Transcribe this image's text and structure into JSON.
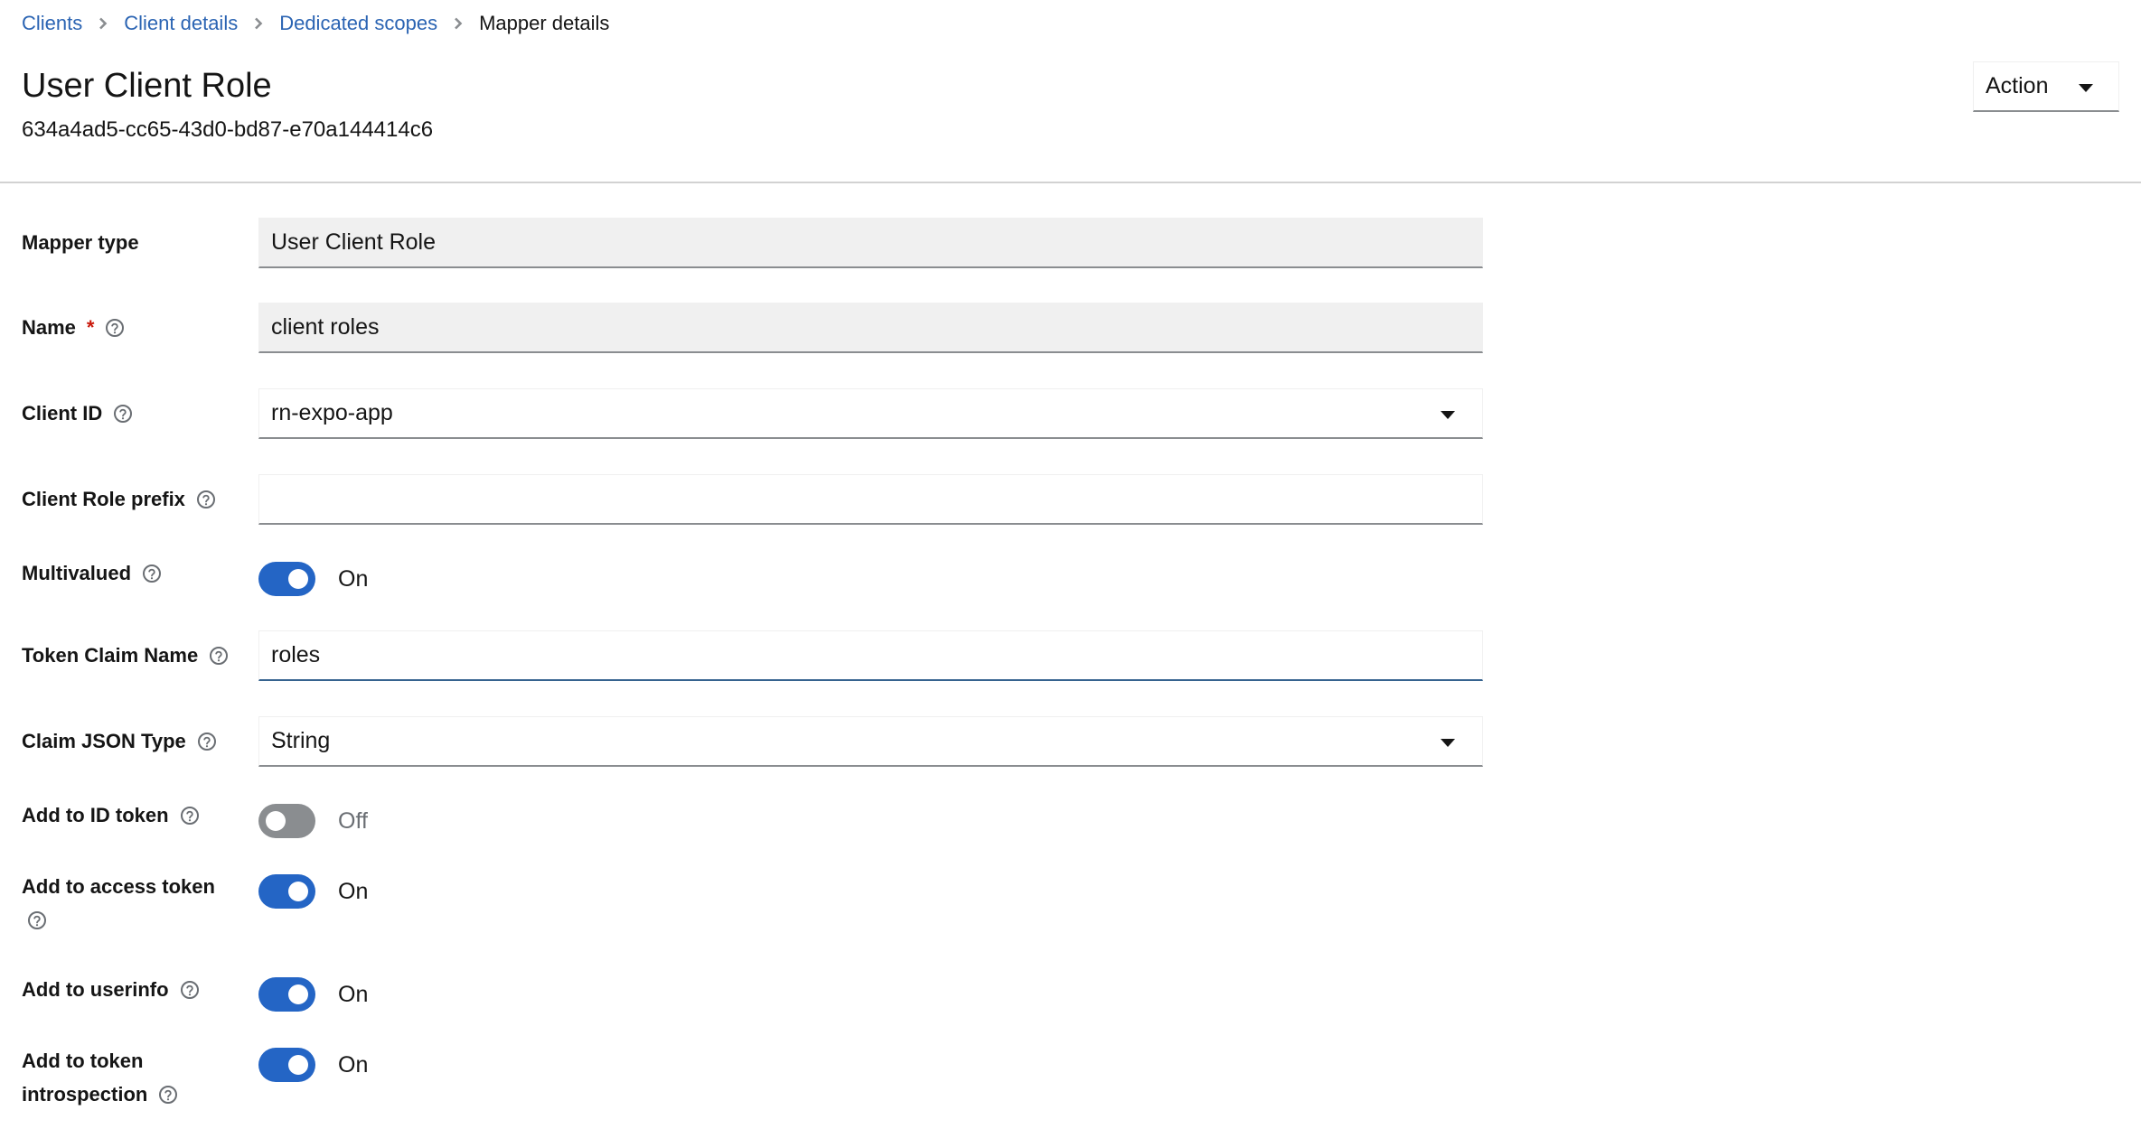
{
  "breadcrumb": {
    "items": [
      {
        "label": "Clients",
        "link": true
      },
      {
        "label": "Client details",
        "link": true
      },
      {
        "label": "Dedicated scopes",
        "link": true
      },
      {
        "label": "Mapper details",
        "link": false
      }
    ]
  },
  "header": {
    "title": "User Client Role",
    "id": "634a4ad5-cc65-43d0-bd87-e70a144414c6",
    "action_label": "Action"
  },
  "form": {
    "mapper_type": {
      "label": "Mapper type",
      "value": "User Client Role"
    },
    "name": {
      "label": "Name",
      "required_marker": "*",
      "value": "client roles"
    },
    "client_id": {
      "label": "Client ID",
      "value": "rn-expo-app"
    },
    "client_role_prefix": {
      "label": "Client Role prefix",
      "value": ""
    },
    "multivalued": {
      "label": "Multivalued",
      "checked": true,
      "state_text": "On"
    },
    "token_claim_name": {
      "label": "Token Claim Name",
      "value": "roles"
    },
    "claim_json_type": {
      "label": "Claim JSON Type",
      "value": "String"
    },
    "add_to_id_token": {
      "label": "Add to ID token",
      "checked": false,
      "state_text": "Off"
    },
    "add_to_access_token": {
      "label": "Add to access token",
      "checked": true,
      "state_text": "On"
    },
    "add_to_userinfo": {
      "label": "Add to userinfo",
      "checked": true,
      "state_text": "On"
    },
    "add_to_token_introspection": {
      "label_line1": "Add to token",
      "label_line2": "introspection",
      "checked": true,
      "state_text": "On"
    }
  },
  "colors": {
    "link": "#2b64b3",
    "toggle_on": "#2465c5",
    "toggle_off": "#8a8d90",
    "required": "#c9190b",
    "readonly_bg": "#f0f0f0"
  }
}
